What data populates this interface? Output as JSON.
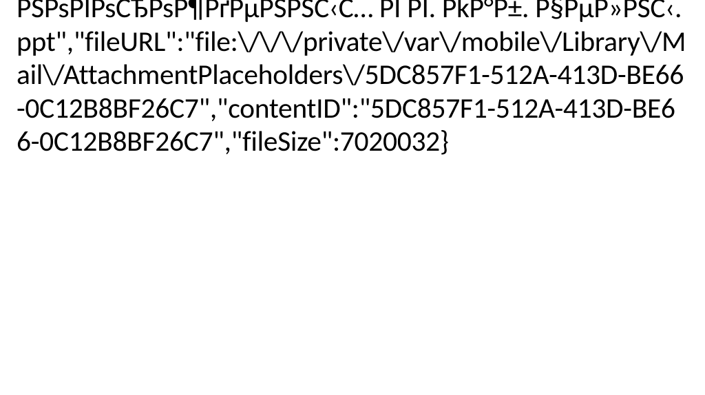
{
  "document": {
    "body_text": "PSPsPIPsCЂPsP¶PґPµPSPSC‹C… PI PI. PkP°P±. P§PµP»PSC‹.ppt\",\"fileURL\":\"file:\\/\\/\\/private\\/var\\/mobile\\/Library\\/Mail\\/AttachmentPlaceholders\\/5DC857F1-512A-413D-BE66-0C12B8BF26C7\",\"contentID\":\"5DC857F1-512A-413D-BE66-0C12B8BF26C7\",\"fileSize\":7020032}"
  }
}
